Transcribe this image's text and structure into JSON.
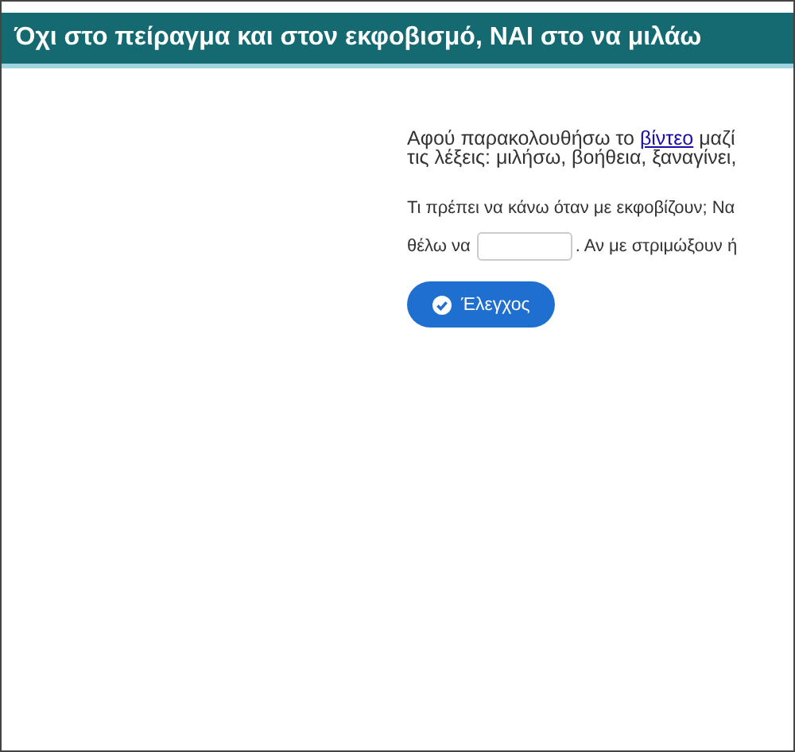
{
  "header": {
    "title": "Όχι στο πείραγμα και στον εκφοβισμό, ΝΑΙ στο να μιλάω"
  },
  "intro": {
    "before": "Αφού παρακολουθήσω το",
    "link": "βίντεο",
    "after": "μαζί",
    "line2": "τις λέξεις: μιλήσω, βοήθεια, ξαναγίνει,"
  },
  "exercise": {
    "line1": "Τι πρέπει να κάνω όταν με εκφοβίζουν; Να",
    "line2_before": "θέλω να",
    "line2_after": ". Αν με στριμώξουν ή"
  },
  "check_button": {
    "label": "Έλεγχος"
  }
}
